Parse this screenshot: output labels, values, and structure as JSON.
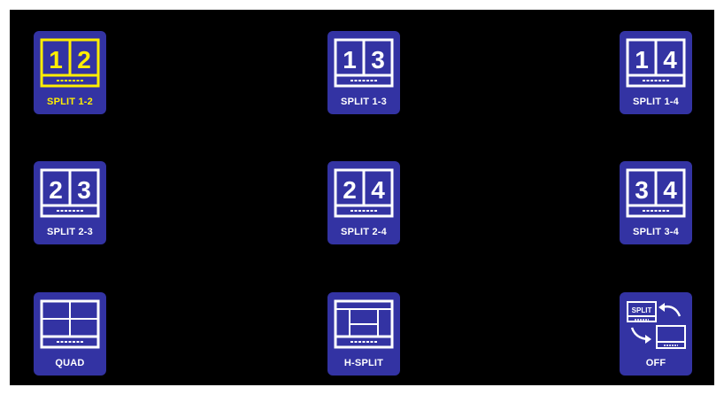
{
  "colors": {
    "screen_background": "#000000",
    "tile_background": "#3333a3",
    "icon_normal": "#ffffff",
    "icon_selected": "#ffee00"
  },
  "modes": [
    {
      "id": "split-1-2",
      "label": "SPLIT 1-2",
      "icon": "split-monitor-icon",
      "left": "1",
      "right": "2",
      "selected": true
    },
    {
      "id": "split-1-3",
      "label": "SPLIT 1-3",
      "icon": "split-monitor-icon",
      "left": "1",
      "right": "3",
      "selected": false
    },
    {
      "id": "split-1-4",
      "label": "SPLIT 1-4",
      "icon": "split-monitor-icon",
      "left": "1",
      "right": "4",
      "selected": false
    },
    {
      "id": "split-2-3",
      "label": "SPLIT 2-3",
      "icon": "split-monitor-icon",
      "left": "2",
      "right": "3",
      "selected": false
    },
    {
      "id": "split-2-4",
      "label": "SPLIT 2-4",
      "icon": "split-monitor-icon",
      "left": "2",
      "right": "4",
      "selected": false
    },
    {
      "id": "split-3-4",
      "label": "SPLIT 3-4",
      "icon": "split-monitor-icon",
      "left": "3",
      "right": "4",
      "selected": false
    },
    {
      "id": "quad",
      "label": "QUAD",
      "icon": "quad-monitor-icon",
      "selected": false
    },
    {
      "id": "h-split",
      "label": "H-SPLIT",
      "icon": "h-split-monitor-icon",
      "selected": false
    },
    {
      "id": "off",
      "label": "OFF",
      "icon": "split-off-icon",
      "icon_text": "SPLIT",
      "selected": false
    }
  ]
}
